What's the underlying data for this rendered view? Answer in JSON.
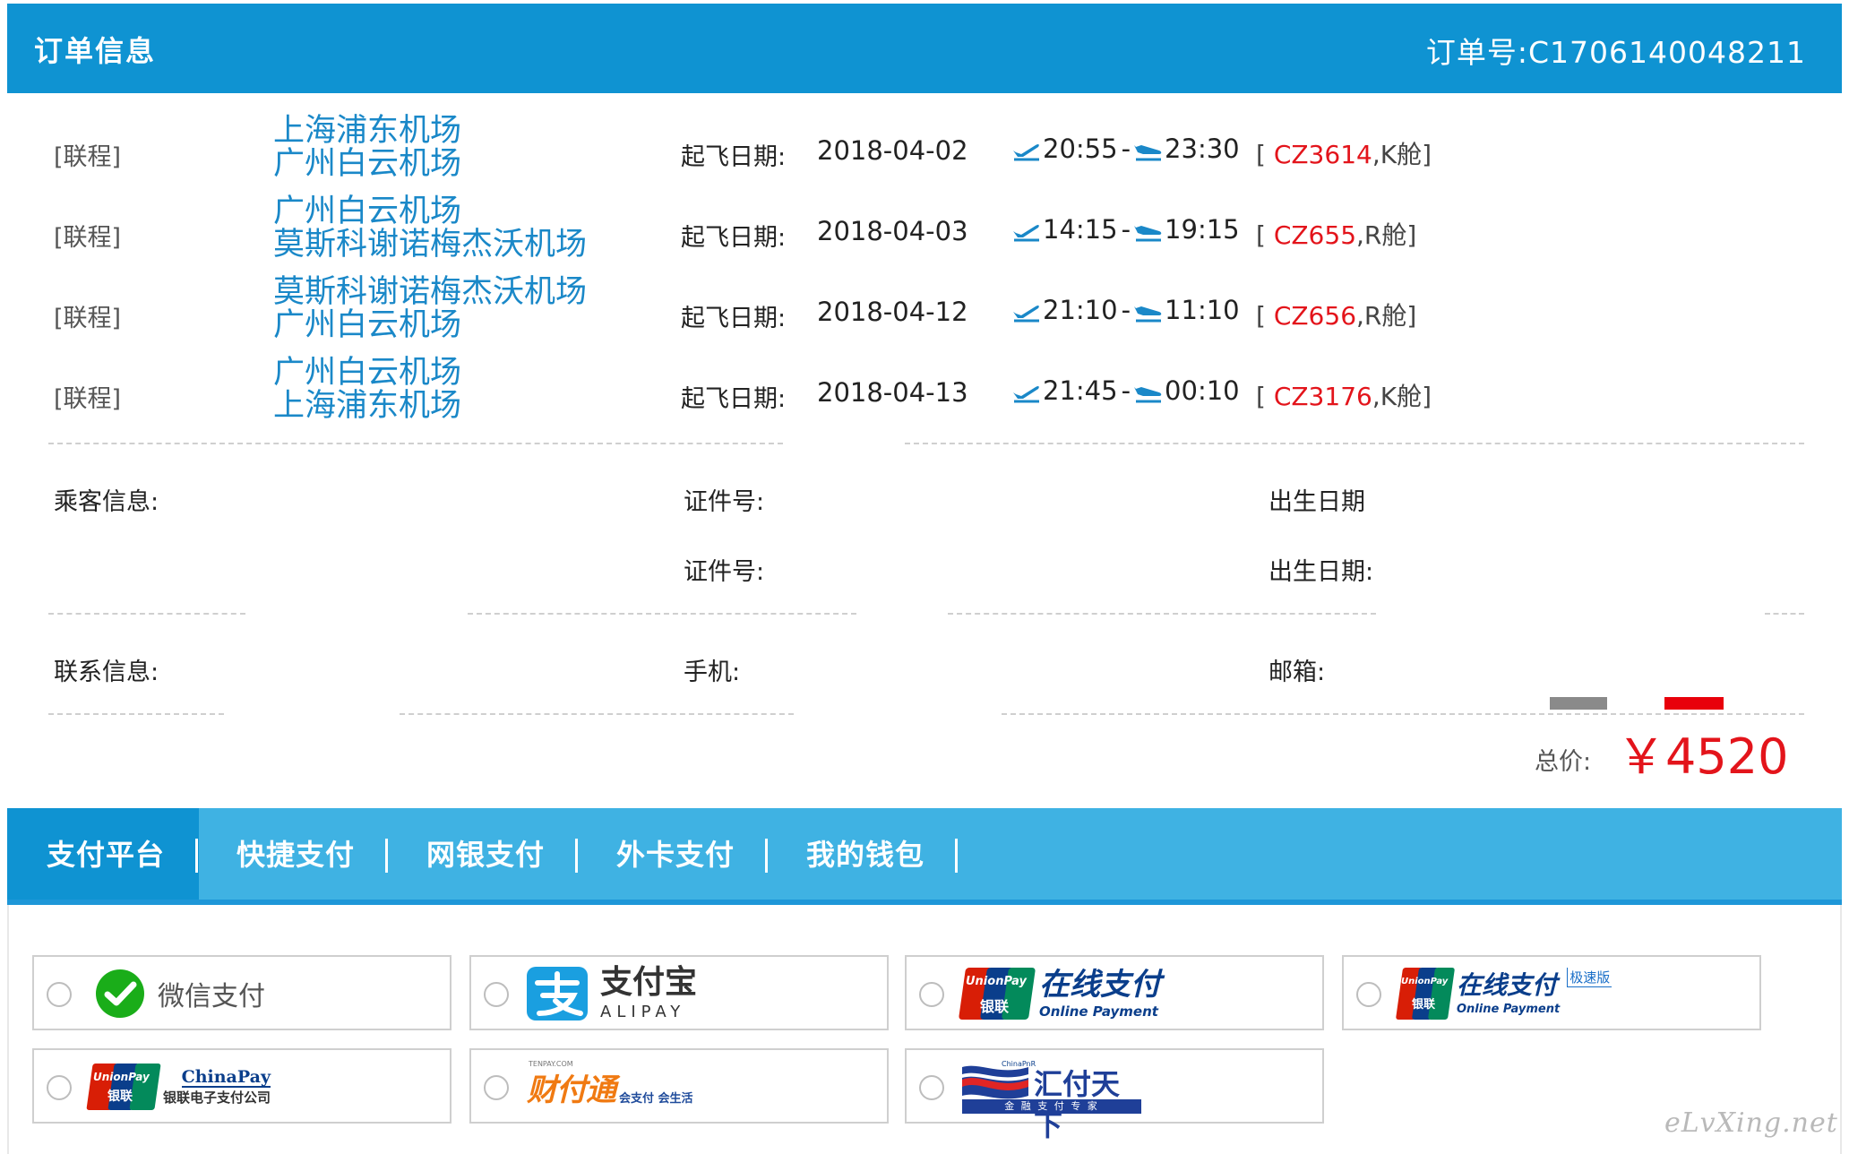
{
  "header": {
    "title": "订单信息",
    "order_number": "订单号:C1706140048211"
  },
  "flights": [
    {
      "tag": "[联程]",
      "from": "上海浦东机场",
      "to": "广州白云机场",
      "date_label": "起飞日期:",
      "date": "2018-04-02",
      "depart": "20:55",
      "arrive": "23:30",
      "flight_code": "CZ3614",
      "cabin": ",K舱]",
      "bracket": "[ "
    },
    {
      "tag": "[联程]",
      "from": "广州白云机场",
      "to": "莫斯科谢诺梅杰沃机场",
      "date_label": "起飞日期:",
      "date": "2018-04-03",
      "depart": "14:15",
      "arrive": "19:15",
      "flight_code": "CZ655",
      "cabin": ",R舱]",
      "bracket": "[ "
    },
    {
      "tag": "[联程]",
      "from": "莫斯科谢诺梅杰沃机场",
      "to": "广州白云机场",
      "date_label": "起飞日期:",
      "date": "2018-04-12",
      "depart": "21:10",
      "arrive": "11:10",
      "flight_code": "CZ656",
      "cabin": ",R舱]",
      "bracket": "[ "
    },
    {
      "tag": "[联程]",
      "from": "广州白云机场",
      "to": "上海浦东机场",
      "date_label": "起飞日期:",
      "date": "2018-04-13",
      "depart": "21:45",
      "arrive": "00:10",
      "flight_code": "CZ3176",
      "cabin": ",K舱]",
      "bracket": "[ "
    }
  ],
  "time_separator": " -",
  "passenger": {
    "label": "乘客信息:",
    "id_label_1": "证件号:",
    "birth_label_1": "出生日期",
    "id_label_2": "证件号:",
    "birth_label_2": "出生日期:"
  },
  "contact": {
    "label": "联系信息:",
    "phone_label": "手机:",
    "email_label": "邮箱:"
  },
  "total": {
    "label": "总价:",
    "value": "￥4520"
  },
  "tabs": [
    {
      "label": "支付平台",
      "active": true
    },
    {
      "label": "快捷支付",
      "active": false
    },
    {
      "label": "网银支付",
      "active": false
    },
    {
      "label": "外卡支付",
      "active": false
    },
    {
      "label": "我的钱包",
      "active": false
    }
  ],
  "tab_separator": "|",
  "payments": {
    "wechat": "微信支付",
    "alipay_cn": "支付宝",
    "alipay_en": "ALIPAY",
    "unionpay_online": "在线支付",
    "unionpay_online_en": "Online Payment",
    "unionpay_logo_en": "UnionPay",
    "unionpay_logo_cn": "银联",
    "unionpay_fast": "在线支付",
    "unionpay_fast_en": "Online Payment",
    "unionpay_fast_badge": "极速版",
    "chinapay_en": "ChinaPay",
    "chinapay_cn": "银联电子支付公司",
    "tenpay": "财付通",
    "tenpay_sub": "会支付 会生活",
    "tenpay_small": "TENPAY.COM",
    "huifu": "汇付天下",
    "huifu_sub": "金 融 支 付 专 家",
    "huifu_tag": "ChinaPnR"
  },
  "watermark": "eLvXing.net",
  "colors": {
    "header_blue": "#0f93d2",
    "tab_blue": "#3fb2e3",
    "route_blue": "#1a88c8",
    "price_red": "#e3141b"
  }
}
